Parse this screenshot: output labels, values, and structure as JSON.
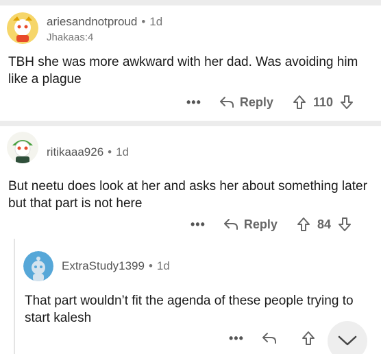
{
  "comments": [
    {
      "username": "ariesandnotproud",
      "separator": "•",
      "age": "1d",
      "flair": "Jhakaas:4",
      "body": "TBH she was more awkward with her dad. Was avoiding him like a plague",
      "more": "•••",
      "reply_label": "Reply",
      "score": "110"
    },
    {
      "username": "ritikaaa926",
      "separator": "•",
      "age": "1d",
      "body": "But neetu does look at her and asks her about something later but that part is not here",
      "more": "•••",
      "reply_label": "Reply",
      "score": "84"
    },
    {
      "username": "ExtraStudy1399",
      "separator": "•",
      "age": "1d",
      "body": "That part wouldn’t fit the agenda of these people trying to start kalesh",
      "more": "•••"
    }
  ],
  "colors": {
    "text": "#1c1c1c",
    "meta": "#777777",
    "separator_band": "#ececec",
    "avatar3_bg": "#56a7d8"
  },
  "icons": [
    "snoo-avatar-icon",
    "reply-arrow-icon",
    "upvote-icon",
    "downvote-icon",
    "chevron-down-icon"
  ]
}
